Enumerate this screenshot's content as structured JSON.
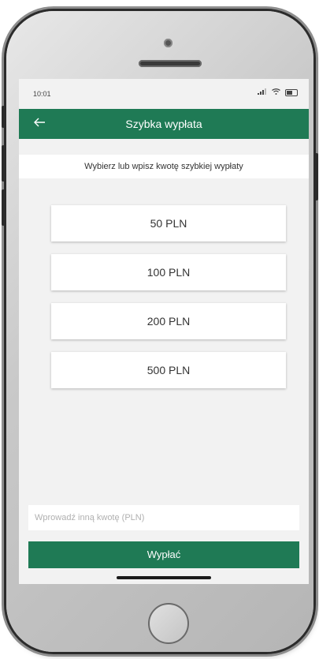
{
  "status_bar": {
    "time": "10:01",
    "signal_icon": "signal-bars-icon",
    "wifi_icon": "wifi-icon",
    "battery_icon": "battery-icon"
  },
  "header": {
    "back_icon": "arrow-left-icon",
    "title": "Szybka wypłata"
  },
  "subheader": {
    "text": "Wybierz lub wpisz kwotę szybkiej wypłaty"
  },
  "amounts": [
    {
      "label": "50 PLN"
    },
    {
      "label": "100 PLN"
    },
    {
      "label": "200 PLN"
    },
    {
      "label": "500 PLN"
    }
  ],
  "custom_amount": {
    "value": "",
    "placeholder": "Wprowadź inną kwotę (PLN)"
  },
  "submit": {
    "label": "Wypłać"
  },
  "colors": {
    "brand_green": "#1f7a55",
    "background": "#f2f2f2"
  }
}
